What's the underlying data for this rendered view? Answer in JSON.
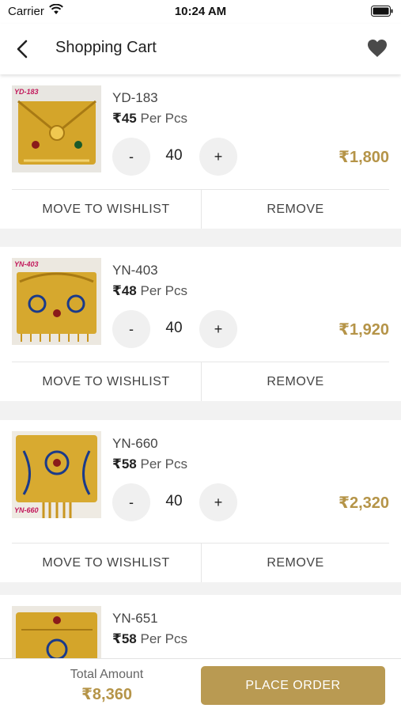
{
  "status_bar": {
    "carrier": "Carrier",
    "time": "10:24 AM"
  },
  "header": {
    "title": "Shopping Cart",
    "back_icon": "chevron-left-icon",
    "wishlist_icon": "heart-icon"
  },
  "colors": {
    "accent": "#b99a52",
    "price": "#b59448",
    "background": "#f2f2f2"
  },
  "cart": {
    "items": [
      {
        "code": "YD-183",
        "thumb_code": "YD-183",
        "price": "₹45",
        "unit": "Per Pcs",
        "minus": "-",
        "qty": "40",
        "plus": "+",
        "total": "₹1,800",
        "wishlist": "MOVE TO WISHLIST",
        "remove": "REMOVE"
      },
      {
        "code": "YN-403",
        "thumb_code": "YN-403",
        "price": "₹48",
        "unit": "Per Pcs",
        "minus": "-",
        "qty": "40",
        "plus": "+",
        "total": "₹1,920",
        "wishlist": "MOVE TO WISHLIST",
        "remove": "REMOVE"
      },
      {
        "code": "YN-660",
        "thumb_code": "YN-660",
        "price": "₹58",
        "unit": "Per Pcs",
        "minus": "-",
        "qty": "40",
        "plus": "+",
        "total": "₹2,320",
        "wishlist": "MOVE TO WISHLIST",
        "remove": "REMOVE"
      },
      {
        "code": "YN-651",
        "thumb_code": "",
        "price": "₹58",
        "unit": "Per Pcs"
      }
    ]
  },
  "footer": {
    "total_label": "Total Amount",
    "total_value": "₹8,360",
    "place_order": "PLACE ORDER"
  }
}
